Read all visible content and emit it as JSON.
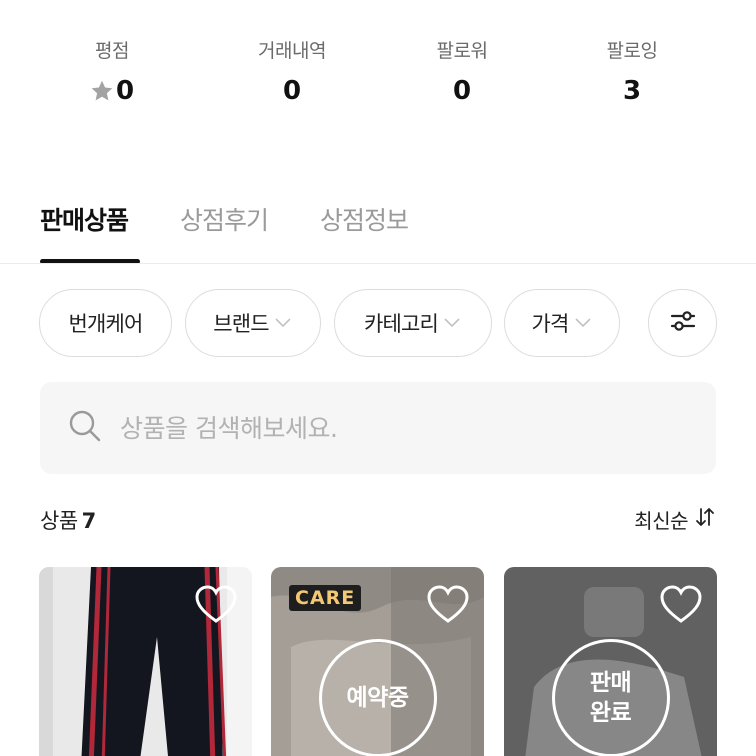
{
  "stats": [
    {
      "label": "평점",
      "value": "0",
      "icon": "star-icon"
    },
    {
      "label": "거래내역",
      "value": "0"
    },
    {
      "label": "팔로워",
      "value": "0"
    },
    {
      "label": "팔로잉",
      "value": "3"
    }
  ],
  "tabs": [
    {
      "label": "판매상품",
      "active": true
    },
    {
      "label": "상점후기",
      "active": false
    },
    {
      "label": "상점정보",
      "active": false
    }
  ],
  "filters": [
    {
      "label": "번개케어",
      "dropdown": false
    },
    {
      "label": "브랜드",
      "dropdown": true
    },
    {
      "label": "카테고리",
      "dropdown": true
    },
    {
      "label": "가격",
      "dropdown": true
    },
    {
      "label": "",
      "icon": "filter-settings-icon"
    }
  ],
  "search": {
    "placeholder": "상품을 검색해보세요.",
    "value": ""
  },
  "products_header": {
    "label": "상품",
    "count": "7",
    "sort_label": "최신순"
  },
  "cards": [
    {
      "badge": "",
      "status": "",
      "liked": false
    },
    {
      "badge": "CARE",
      "status": "예약중",
      "liked": false
    },
    {
      "badge": "",
      "status": "판매\n완료",
      "liked": false
    }
  ],
  "colors": {
    "accent_text": "#111111",
    "muted_text": "#9a9a9a",
    "care_badge_bg": "#1e1e1e",
    "care_badge_text": "#f3c875"
  }
}
